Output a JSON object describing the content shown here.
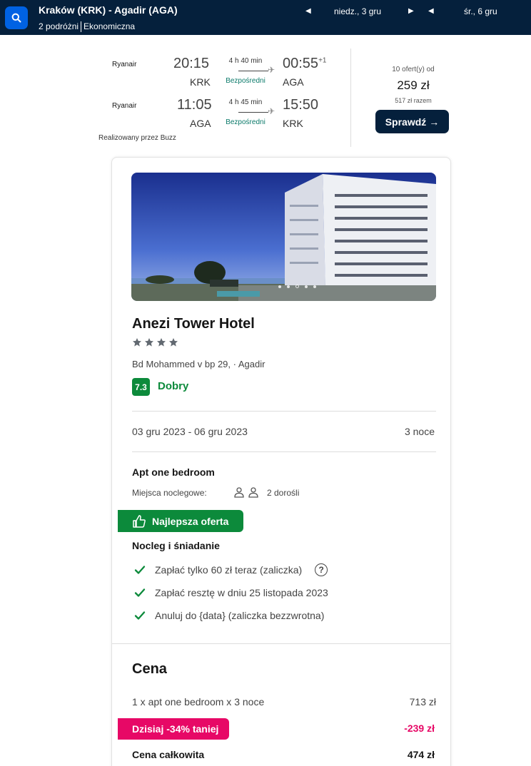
{
  "header": {
    "route": "Kraków (KRK) - Agadir (AGA)",
    "travellers": "2 podróżni",
    "cabin": "Ekonomiczna",
    "depart_date": "niedz., 3 gru",
    "return_date": "śr., 6 gru",
    "search_icon": "search-icon",
    "bg_color": "#05203c"
  },
  "flight": {
    "outbound": {
      "airline": "Ryanair",
      "dep_time": "20:15",
      "dep_code": "KRK",
      "duration": "4 h 40 min",
      "stops": "Bezpośredni",
      "arr_time": "00:55",
      "arr_plus": "+1",
      "arr_code": "AGA"
    },
    "inbound": {
      "airline": "Ryanair",
      "dep_time": "11:05",
      "dep_code": "AGA",
      "duration": "4 h 45 min",
      "stops": "Bezpośredni",
      "arr_time": "15:50",
      "arr_code": "KRK"
    },
    "operated_by": "Realizowany przez Buzz",
    "offers": "10 ofert(y) od",
    "price": "259 zł",
    "total": "517 zł razem",
    "cta": "Sprawdź"
  },
  "hotel": {
    "name": "Anezi Tower Hotel",
    "stars": 4,
    "address": "Bd Mohammed v bp 29, · Agadir",
    "rating": "7.3",
    "rating_label": "Dobry",
    "dates": "03 gru 2023 - 06 gru 2023",
    "nights": "3 noce",
    "room": "Apt one bedroom",
    "beds_label": "Miejsca noclegowe:",
    "guests": "2 dorośli",
    "best_offer": "Najlepsza oferta",
    "board": "Nocleg i śniadanie",
    "features": [
      "Zapłać tylko 60 zł teraz (zaliczka)",
      "Zapłać resztę w dniu 25 listopada 2023",
      "Anuluj do {data} (zaliczka bezzwrotna)"
    ],
    "accent_color": "#0c8a3b"
  },
  "price": {
    "title": "Cena",
    "line_label": "1 x apt one bedroom x 3 noce",
    "line_value": "713 zł",
    "discount_label": "Dzisiaj -34% taniej",
    "discount_value": "-239 zł",
    "total_label": "Cena całkowita",
    "total_value": "474 zł",
    "discount_color": "#e70866"
  }
}
